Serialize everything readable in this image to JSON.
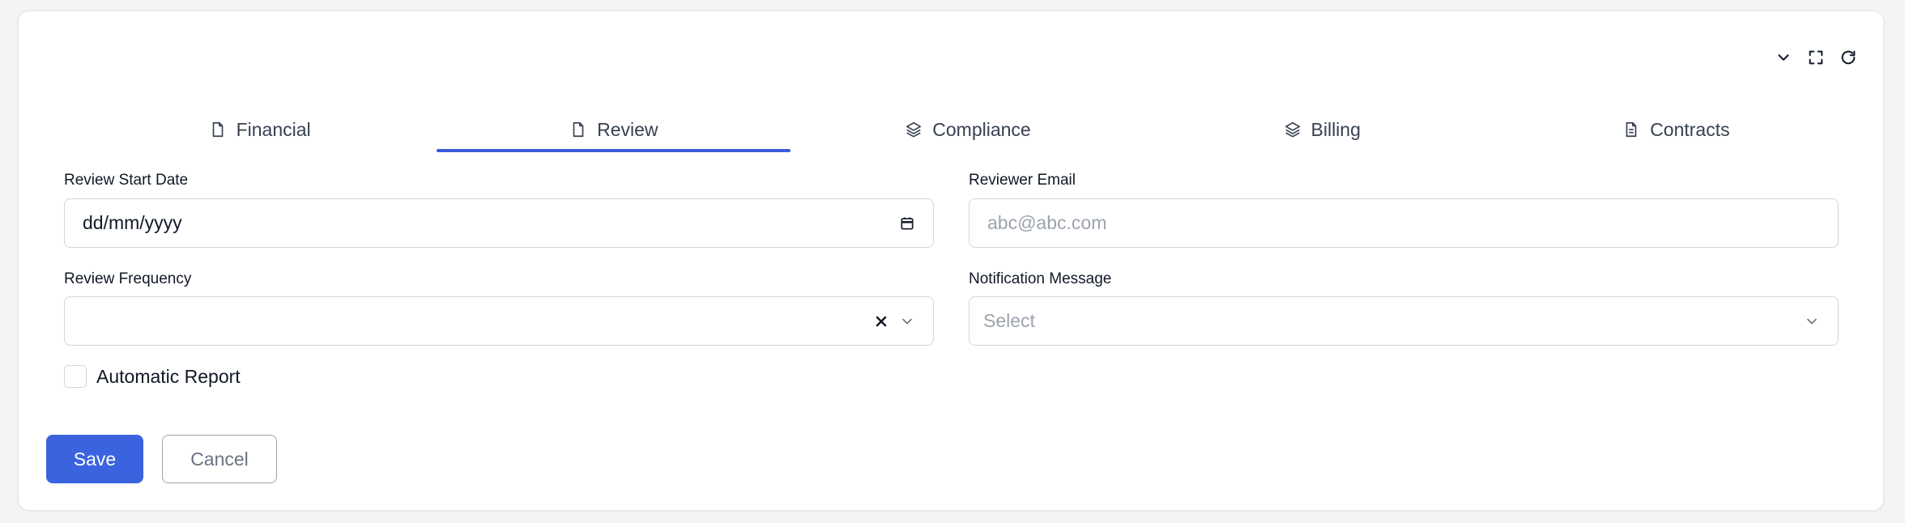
{
  "toolbar": {
    "icons": [
      "chevron-down-icon",
      "fullscreen-icon",
      "refresh-icon"
    ]
  },
  "tabs": [
    {
      "label": "Financial",
      "icon": "file-icon",
      "active": false
    },
    {
      "label": "Review",
      "icon": "file-icon",
      "active": true
    },
    {
      "label": "Compliance",
      "icon": "layers-icon",
      "active": false
    },
    {
      "label": "Billing",
      "icon": "layers-icon",
      "active": false
    },
    {
      "label": "Contracts",
      "icon": "file-text-icon",
      "active": false
    }
  ],
  "form": {
    "review_start_date": {
      "label": "Review Start Date",
      "value": "dd/mm/yyyy"
    },
    "reviewer_email": {
      "label": "Reviewer Email",
      "placeholder": "abc@abc.com"
    },
    "review_frequency": {
      "label": "Review Frequency",
      "value": ""
    },
    "notification_message": {
      "label": "Notification Message",
      "placeholder": "Select"
    },
    "automatic_report": {
      "label": "Automatic Report",
      "checked": false
    }
  },
  "actions": {
    "save_label": "Save",
    "cancel_label": "Cancel"
  },
  "colors": {
    "accent": "#3b63e0",
    "tab_underline": "#3b5bdb",
    "border": "#d1d5db",
    "placeholder": "#9ca3af"
  }
}
